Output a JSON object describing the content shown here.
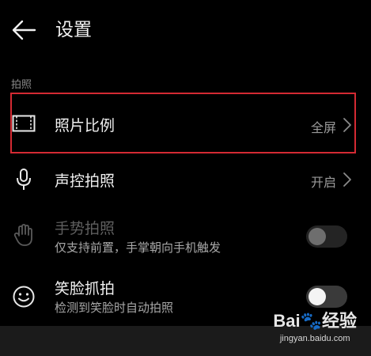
{
  "header": {
    "title": "设置",
    "back_icon": "back-arrow-icon"
  },
  "section": {
    "label": "拍照"
  },
  "rows": [
    {
      "icon": "aspect-ratio-icon",
      "title": "照片比例",
      "value": "全屏",
      "control": "chevron"
    },
    {
      "icon": "microphone-icon",
      "title": "声控拍照",
      "value": "开启",
      "control": "chevron"
    },
    {
      "icon": "hand-gesture-icon",
      "title": "手势拍照",
      "subtitle": "仅支持前置，手掌朝向手机触发",
      "control": "toggle",
      "enabled": false,
      "state": "off"
    },
    {
      "icon": "smile-face-icon",
      "title": "笑脸抓拍",
      "subtitle": "检测到笑脸时自动拍照",
      "control": "toggle",
      "enabled": true,
      "state": "off"
    }
  ],
  "watermark": {
    "logo_text": "Bai",
    "logo_text2": "经验",
    "url": "jingyan.baidu.com"
  },
  "colors": {
    "background": "#000000",
    "highlight": "#d42a33",
    "text_primary": "#f0f0f0",
    "text_secondary": "#a8a8a8"
  }
}
